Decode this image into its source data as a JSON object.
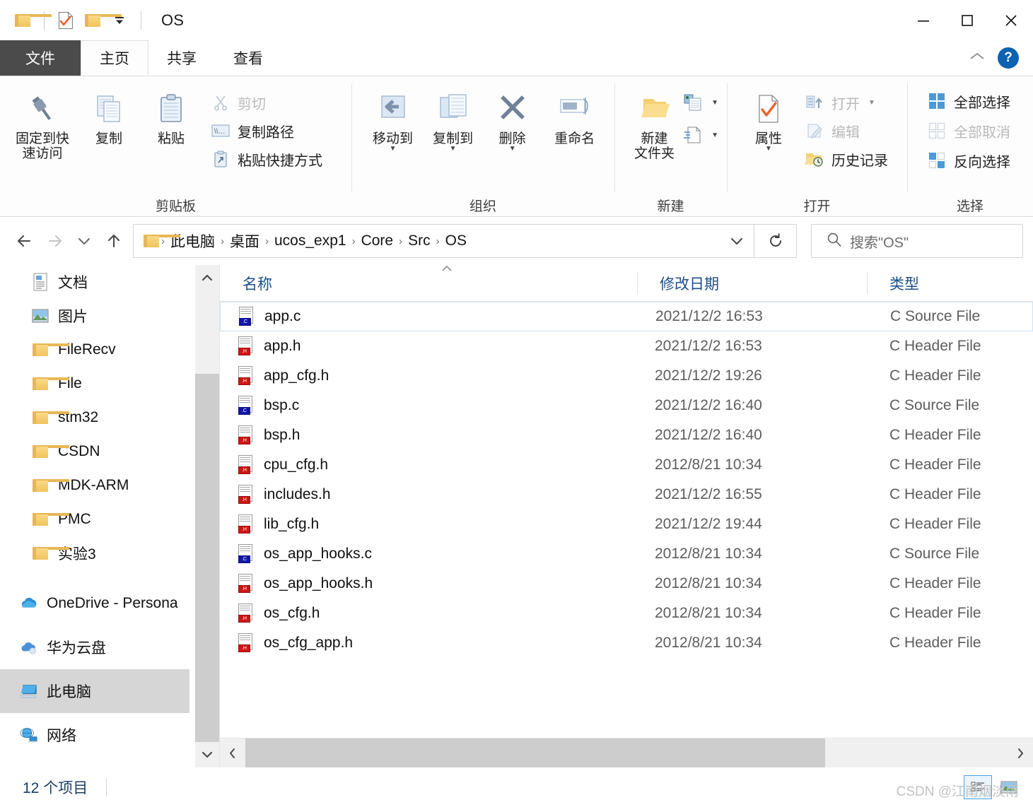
{
  "window": {
    "title": "OS",
    "quick_access": [
      {
        "name": "folder-icon",
        "label": "文件资源管理器"
      },
      {
        "name": "properties-icon",
        "label": "属性"
      },
      {
        "name": "new-folder-icon",
        "label": "新建文件夹"
      },
      {
        "name": "customize-caret-icon",
        "label": "自定义快速访问工具栏"
      }
    ],
    "caption_buttons": {
      "minimize": "—",
      "maximize": "▢",
      "close": "✕"
    }
  },
  "ribbon": {
    "tabs": [
      {
        "label": "文件",
        "kind": "file"
      },
      {
        "label": "主页",
        "kind": "active"
      },
      {
        "label": "共享",
        "kind": "normal"
      },
      {
        "label": "查看",
        "kind": "normal"
      }
    ],
    "collapse_label": "^",
    "help_label": "?",
    "groups": [
      {
        "label": "剪贴板",
        "big": [
          {
            "label": "固定到快\n速访问",
            "icon": "pin-icon",
            "caret": false
          },
          {
            "label": "复制",
            "icon": "copy-icon",
            "caret": false
          },
          {
            "label": "粘贴",
            "icon": "paste-icon",
            "caret": false
          }
        ],
        "small": [
          {
            "label": "剪切",
            "icon": "scissors-icon",
            "disabled": true
          },
          {
            "label": "复制路径",
            "icon": "copy-path-icon",
            "disabled": false
          },
          {
            "label": "粘贴快捷方式",
            "icon": "paste-shortcut-icon",
            "disabled": false
          }
        ]
      },
      {
        "label": "组织",
        "big": [
          {
            "label": "移动到",
            "icon": "move-to-icon",
            "caret": true
          },
          {
            "label": "复制到",
            "icon": "copy-to-icon",
            "caret": true
          },
          {
            "label": "删除",
            "icon": "delete-icon",
            "caret": true
          },
          {
            "label": "重命名",
            "icon": "rename-icon",
            "caret": false
          }
        ],
        "small": []
      },
      {
        "label": "新建",
        "big": [
          {
            "label": "新建\n文件夹",
            "icon": "new-folder-icon",
            "caret": false
          }
        ],
        "small": [
          {
            "label": "",
            "icon": "new-item-icon",
            "disabled": false,
            "caret": true
          },
          {
            "label": "",
            "icon": "easy-access-icon",
            "disabled": false,
            "caret": true
          }
        ]
      },
      {
        "label": "打开",
        "big": [
          {
            "label": "属性",
            "icon": "properties-icon",
            "caret": true
          }
        ],
        "small": [
          {
            "label": "打开",
            "icon": "open-icon",
            "disabled": true,
            "caret": true
          },
          {
            "label": "编辑",
            "icon": "edit-icon",
            "disabled": true
          },
          {
            "label": "历史记录",
            "icon": "history-icon",
            "disabled": false
          }
        ]
      },
      {
        "label": "选择",
        "big": [],
        "small": [
          {
            "label": "全部选择",
            "icon": "select-all-icon",
            "disabled": false
          },
          {
            "label": "全部取消",
            "icon": "select-none-icon",
            "disabled": true
          },
          {
            "label": "反向选择",
            "icon": "invert-selection-icon",
            "disabled": false
          }
        ]
      }
    ]
  },
  "address": {
    "back_label": "←",
    "forward_label": "→",
    "recent_label": "⌄",
    "up_label": "↑",
    "crumbs": [
      "此电脑",
      "桌面",
      "ucos_exp1",
      "Core",
      "Src",
      "OS"
    ],
    "separator": "›",
    "dropdown_label": "⌄",
    "refresh_label": "↻",
    "search_placeholder": "搜索\"OS\""
  },
  "sidebar": {
    "quick_items": [
      {
        "label": "文档",
        "icon": "document-icon",
        "pinned": true
      },
      {
        "label": "图片",
        "icon": "pictures-icon",
        "pinned": true
      },
      {
        "label": "FileRecv",
        "icon": "folder-icon",
        "pinned": true
      },
      {
        "label": "File",
        "icon": "folder-icon",
        "pinned": true
      },
      {
        "label": "stm32",
        "icon": "folder-icon",
        "pinned": true
      },
      {
        "label": "CSDN",
        "icon": "folder-icon",
        "pinned": false
      },
      {
        "label": "MDK-ARM",
        "icon": "folder-icon",
        "pinned": false
      },
      {
        "label": "PMC",
        "icon": "folder-icon",
        "pinned": false
      },
      {
        "label": "实验3",
        "icon": "folder-icon",
        "pinned": false
      }
    ],
    "root_items": [
      {
        "label": "OneDrive - Persona",
        "icon": "onedrive-icon",
        "selected": false
      },
      {
        "label": "华为云盘",
        "icon": "cloud-icon",
        "selected": false
      },
      {
        "label": "此电脑",
        "icon": "this-pc-icon",
        "selected": true
      },
      {
        "label": "网络",
        "icon": "network-icon",
        "selected": false
      }
    ],
    "scroll_up": "⌃",
    "scroll_down": "⌄"
  },
  "filelist": {
    "columns": [
      "名称",
      "修改日期",
      "类型"
    ],
    "rows": [
      {
        "name": "app.c",
        "date": "2021/12/2 16:53",
        "type": "C Source File",
        "ext": "c",
        "selected": true
      },
      {
        "name": "app.h",
        "date": "2021/12/2 16:53",
        "type": "C Header File",
        "ext": "h",
        "selected": false
      },
      {
        "name": "app_cfg.h",
        "date": "2021/12/2 19:26",
        "type": "C Header File",
        "ext": "h",
        "selected": false
      },
      {
        "name": "bsp.c",
        "date": "2021/12/2 16:40",
        "type": "C Source File",
        "ext": "c",
        "selected": false
      },
      {
        "name": "bsp.h",
        "date": "2021/12/2 16:40",
        "type": "C Header File",
        "ext": "h",
        "selected": false
      },
      {
        "name": "cpu_cfg.h",
        "date": "2012/8/21 10:34",
        "type": "C Header File",
        "ext": "h",
        "selected": false
      },
      {
        "name": "includes.h",
        "date": "2021/12/2 16:55",
        "type": "C Header File",
        "ext": "h",
        "selected": false
      },
      {
        "name": "lib_cfg.h",
        "date": "2021/12/2 19:44",
        "type": "C Header File",
        "ext": "h",
        "selected": false
      },
      {
        "name": "os_app_hooks.c",
        "date": "2012/8/21 10:34",
        "type": "C Source File",
        "ext": "c",
        "selected": false
      },
      {
        "name": "os_app_hooks.h",
        "date": "2012/8/21 10:34",
        "type": "C Header File",
        "ext": "h",
        "selected": false
      },
      {
        "name": "os_cfg.h",
        "date": "2012/8/21 10:34",
        "type": "C Header File",
        "ext": "h",
        "selected": false
      },
      {
        "name": "os_cfg_app.h",
        "date": "2012/8/21 10:34",
        "type": "C Header File",
        "ext": "h",
        "selected": false
      }
    ],
    "hscroll_left": "‹",
    "hscroll_right": "›"
  },
  "status": {
    "item_count": "12 个项目",
    "view_details_label": "详细信息",
    "view_large_icons_label": "大图标",
    "watermark": "CSDN @江南烟淡雨"
  }
}
